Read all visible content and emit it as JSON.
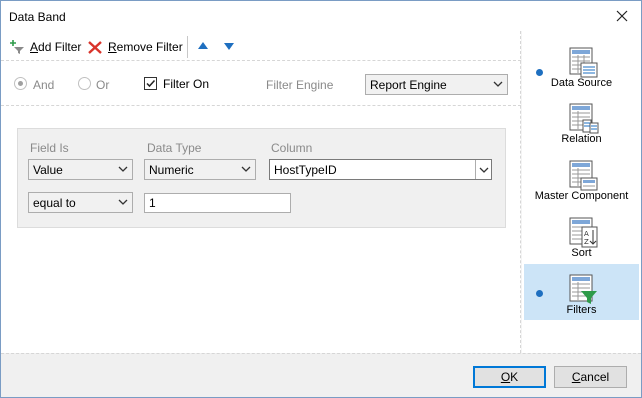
{
  "window": {
    "title": "Data Band"
  },
  "toolbar": {
    "add_filter_prefix": "",
    "add_filter_underline": "A",
    "add_filter_rest": "dd Filter",
    "remove_filter_underline": "R",
    "remove_filter_rest": "emove Filter"
  },
  "options": {
    "and_label": "And",
    "or_label": "Or",
    "filter_on_label": "Filter On",
    "filter_on_checked": true,
    "filter_engine_label": "Filter Engine",
    "filter_engine_value": "Report Engine"
  },
  "filter": {
    "field_is_label": "Field Is",
    "data_type_label": "Data Type",
    "column_label": "Column",
    "field_is_value": "Value",
    "data_type_value": "Numeric",
    "column_value": "HostTypeID",
    "condition_value": "equal to",
    "value": "1"
  },
  "nav": {
    "items": [
      {
        "label": "Data Source",
        "icon": "data-source-icon",
        "dot": true,
        "selected": false
      },
      {
        "label": "Relation",
        "icon": "relation-icon",
        "dot": false,
        "selected": false
      },
      {
        "label": "Master Component",
        "icon": "master-component-icon",
        "dot": false,
        "selected": false
      },
      {
        "label": "Sort",
        "icon": "sort-icon",
        "dot": false,
        "selected": false
      },
      {
        "label": "Filters",
        "icon": "filters-icon",
        "dot": true,
        "selected": true
      }
    ]
  },
  "buttons": {
    "ok_underline": "O",
    "ok_rest": "K",
    "cancel_underline": "C",
    "cancel_rest": "ancel"
  },
  "colors": {
    "accent": "#0078d7",
    "selected_bg": "#cce4f7",
    "dot": "#1e6fc0",
    "remove_red": "#d9342b",
    "filter_green": "#2e9b4a"
  }
}
